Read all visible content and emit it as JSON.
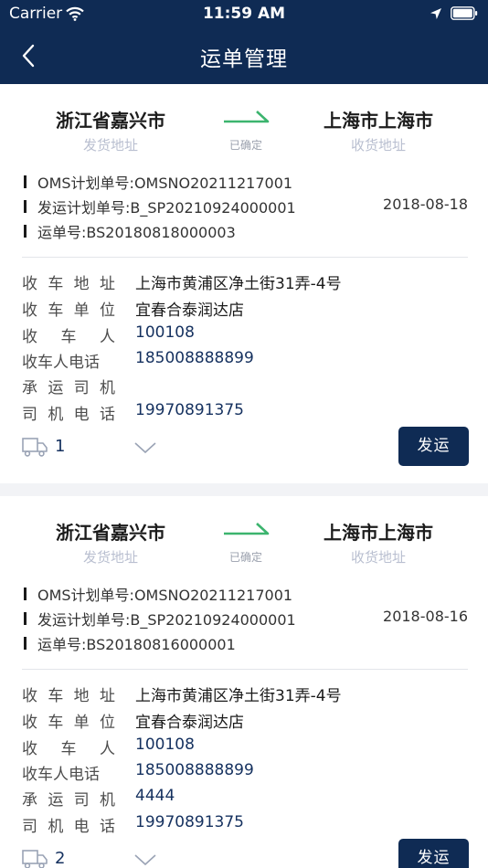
{
  "status_bar": {
    "carrier": "Carrier",
    "time": "11:59 AM"
  },
  "nav": {
    "title": "运单管理"
  },
  "labels": {
    "from_sub": "发货地址",
    "to_sub": "收货地址",
    "oms": "OMS计划单号:",
    "plan": "发运计划单号:",
    "waybill": "运单号:",
    "address": "收车地址",
    "unit": "收车单位",
    "person": "收车人",
    "phone": "收车人电话",
    "driver": "承运司机",
    "driver_phone": "司机电话",
    "ship": "发运"
  },
  "orders": [
    {
      "from_city": "浙江省嘉兴市",
      "to_city": "上海市上海市",
      "status": "已确定",
      "oms_no": "OMSNO20211217001",
      "plan_no": "B_SP20210924000001",
      "date": "2018-08-18",
      "waybill_no": "BS20180818000003",
      "address": "上海市黄浦区净土街31弄-4号",
      "unit": "宜春合泰润达店",
      "person": "100108",
      "phone": "185008888899",
      "driver": "",
      "driver_phone": "19970891375",
      "truck_count": "1"
    },
    {
      "from_city": "浙江省嘉兴市",
      "to_city": "上海市上海市",
      "status": "已确定",
      "oms_no": "OMSNO20211217001",
      "plan_no": "B_SP20210924000001",
      "date": "2018-08-16",
      "waybill_no": "BS20180816000001",
      "address": "上海市黄浦区净土街31弄-4号",
      "unit": "宜春合泰润达店",
      "person": "100108",
      "phone": "185008888899",
      "driver": "4444",
      "driver_phone": "19970891375",
      "truck_count": "2"
    }
  ],
  "colors": {
    "header": "#0f2b54",
    "arrow": "#3cb46e",
    "button": "#0f2b54",
    "value": "#15315f"
  },
  "icons": [
    "wifi-icon",
    "location-icon",
    "battery-icon",
    "back-arrow-icon",
    "arrow-right-icon",
    "truck-icon",
    "chevron-down-icon"
  ]
}
